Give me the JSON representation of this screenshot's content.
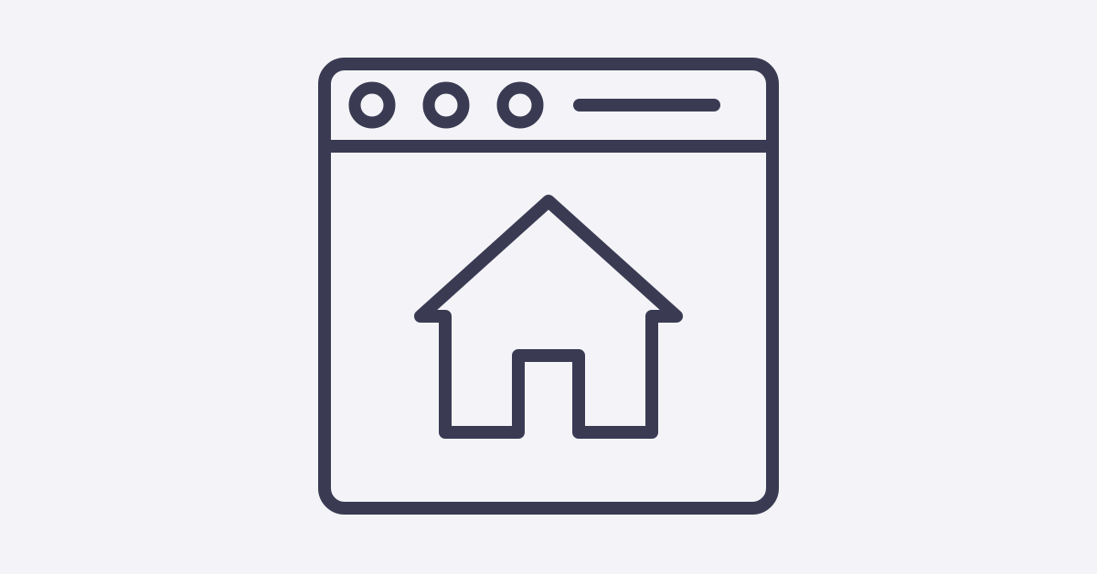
{
  "background_color": "#f4f4f8",
  "stroke_color": "#3a3b53",
  "icon": {
    "name": "homepage-browser-icon",
    "window_dots_count": 3,
    "glyph": "house-icon"
  }
}
